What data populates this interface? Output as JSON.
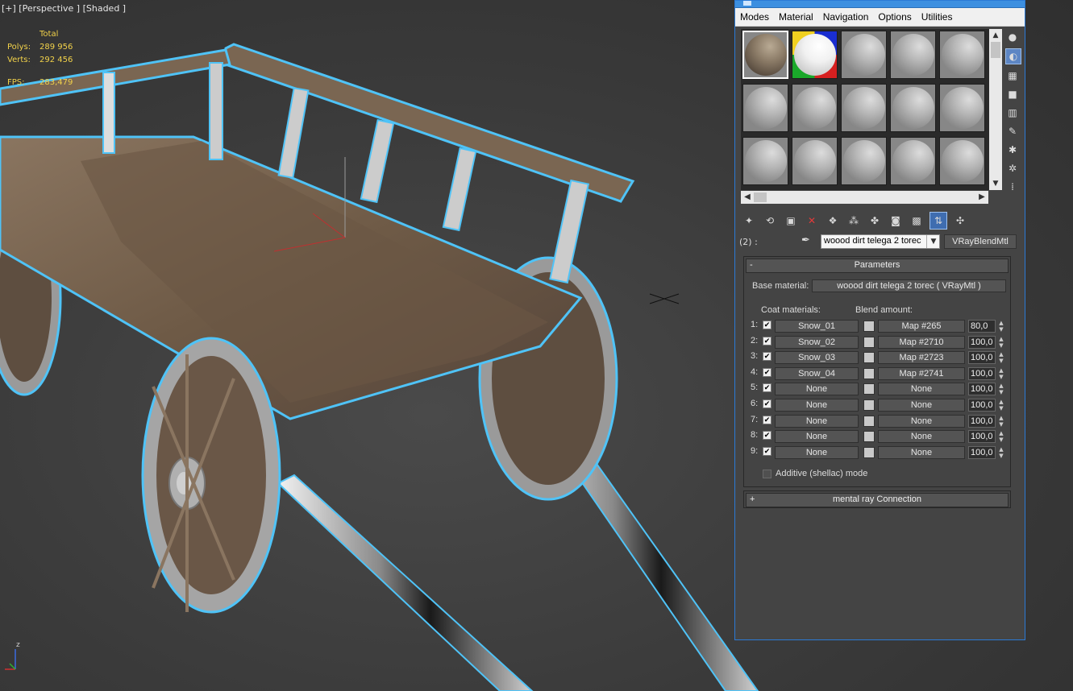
{
  "viewport": {
    "label": "[+] [Perspective ] [Shaded ]",
    "stats": {
      "header": "Total",
      "polys_label": "Polys:",
      "polys_value": "289 956",
      "verts_label": "Verts:",
      "verts_value": "292 456",
      "fps_label": "FPS:",
      "fps_value": "283,479"
    },
    "axis_z": "z"
  },
  "material_editor": {
    "menu": [
      "Modes",
      "Material",
      "Navigation",
      "Options",
      "Utilities"
    ],
    "slot_number": "(2) :",
    "material_name": "woood dirt telega 2 torec",
    "material_type": "VRayBlendMtl",
    "parameters": {
      "title": "Parameters",
      "toggle": "-",
      "base_material_label": "Base material:",
      "base_material_value": "woood dirt telega 2 torec  ( VRayMtl )",
      "coat_materials_label": "Coat materials:",
      "blend_amount_label": "Blend amount:",
      "rows": [
        {
          "n": "1:",
          "coat": "Snow_01",
          "map": "Map #265",
          "amount": "80,0",
          "checked": true
        },
        {
          "n": "2:",
          "coat": "Snow_02",
          "map": "Map #2710",
          "amount": "100,0",
          "checked": true
        },
        {
          "n": "3:",
          "coat": "Snow_03",
          "map": "Map #2723",
          "amount": "100,0",
          "checked": true
        },
        {
          "n": "4:",
          "coat": "Snow_04",
          "map": "Map #2741",
          "amount": "100,0",
          "checked": true
        },
        {
          "n": "5:",
          "coat": "None",
          "map": "None",
          "amount": "100,0",
          "checked": true
        },
        {
          "n": "6:",
          "coat": "None",
          "map": "None",
          "amount": "100,0",
          "checked": true
        },
        {
          "n": "7:",
          "coat": "None",
          "map": "None",
          "amount": "100,0",
          "checked": true
        },
        {
          "n": "8:",
          "coat": "None",
          "map": "None",
          "amount": "100,0",
          "checked": true
        },
        {
          "n": "9:",
          "coat": "None",
          "map": "None",
          "amount": "100,0",
          "checked": true
        }
      ],
      "additive_label": "Additive (shellac) mode",
      "additive_checked": false
    },
    "mental_ray": {
      "title": "mental ray Connection",
      "toggle": "+"
    },
    "slot_types": [
      "dirt",
      "snow",
      "std",
      "std",
      "std",
      "std",
      "std",
      "std",
      "std",
      "std",
      "std",
      "std",
      "std",
      "std",
      "std"
    ],
    "icons": {
      "side_tools": [
        "sample-type-icon",
        "backlight-icon",
        "background-icon",
        "sample-uv-tiling-icon",
        "video-color-check-icon",
        "make-preview-icon",
        "options-icon",
        "select-by-material-icon",
        "material-map-navigator-icon"
      ],
      "toolbar": [
        "get-material-icon",
        "put-to-scene-icon",
        "assign-to-selection-icon",
        "reset-map-icon",
        "make-unique-icon",
        "put-to-library-icon",
        "material-id-channel-icon",
        "show-map-in-viewport-icon",
        "show-end-result-icon",
        "go-to-parent-icon",
        "go-forward-sibling-icon"
      ]
    }
  }
}
